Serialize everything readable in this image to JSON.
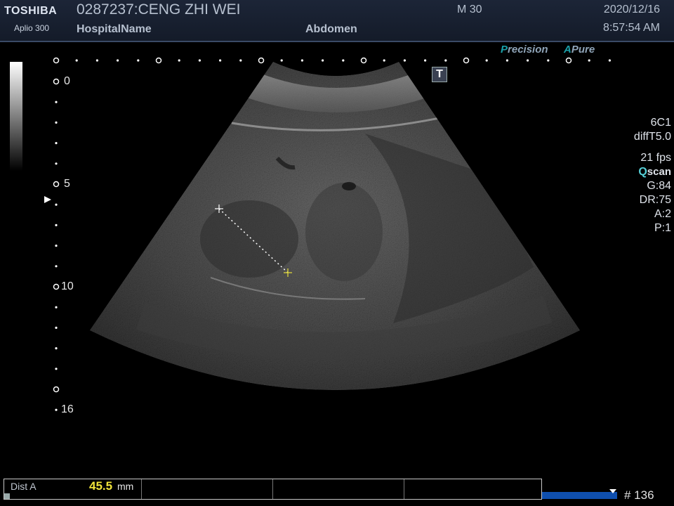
{
  "header": {
    "brand": "TOSHIBA",
    "model": "Aplio 300",
    "patient": "0287237:CENG ZHI WEI",
    "hospital": "HospitalName",
    "mode": "M 30",
    "preset": "Abdomen",
    "date": "2020/12/16",
    "time": "8:57:54 AM"
  },
  "badges": {
    "precision_letter": "P",
    "precision_rest": "recision",
    "apure_letter": "A",
    "apure_rest": "Pure"
  },
  "t_marker": "T",
  "params": {
    "probe": "6C1",
    "harmonic": "diffT5.0",
    "fps": "21 fps",
    "qscan_q": "Q",
    "qscan_rest": "scan",
    "gain": "G:84",
    "dr": "DR:75",
    "a": "A:2",
    "p": "P:1"
  },
  "depth_labels": {
    "d0": "0",
    "d5": "5",
    "d10": "10",
    "d16": "16"
  },
  "measurement": {
    "label": "Dist A",
    "value": "45.5",
    "unit": "mm"
  },
  "frame_counter": "# 136",
  "colors": {
    "header_bg": "#1c2537",
    "measure_value": "#f2e53a",
    "accent_teal": "#1aa0a8",
    "progress": "#0f4fae"
  }
}
